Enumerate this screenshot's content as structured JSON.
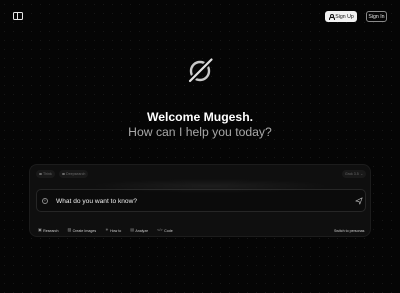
{
  "header": {
    "sign_up_label": "Sign Up",
    "sign_in_label": "Sign In"
  },
  "hero": {
    "welcome": "Welcome Mugesh.",
    "subtitle": "How can I help you today?"
  },
  "composer": {
    "chips": [
      "Think",
      "Deepsearch"
    ],
    "model_label": "Grok 3.5",
    "placeholder": "What do you want to know?",
    "actions": [
      {
        "icon": "research-icon",
        "label": "Research"
      },
      {
        "icon": "image-icon",
        "label": "Create Images"
      },
      {
        "icon": "lightbulb-icon",
        "label": "How to"
      },
      {
        "icon": "analyze-icon",
        "label": "Analyze"
      },
      {
        "icon": "code-icon",
        "label": "Code"
      }
    ],
    "persona_label": "Switch to personas"
  },
  "colors": {
    "background": "#050505",
    "card": "#0f0f0f",
    "subtitle": "#a8a8a8",
    "primary_button": "#f2f2f2"
  }
}
